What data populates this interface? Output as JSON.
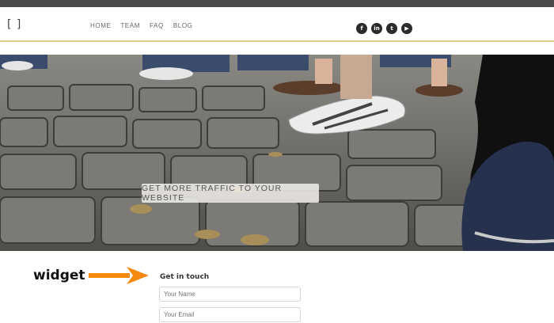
{
  "logo": "[ ]",
  "nav": {
    "items": [
      "HOME",
      "TEAM",
      "FAQ",
      "BLOG"
    ]
  },
  "social": [
    {
      "icon": "facebook-icon",
      "glyph": "f"
    },
    {
      "icon": "linkedin-icon",
      "glyph": "in"
    },
    {
      "icon": "twitter-icon",
      "glyph": "t"
    },
    {
      "icon": "youtube-icon",
      "glyph": "▶"
    }
  ],
  "hero": {
    "cta_label": "GET MORE TRAFFIC TO YOUR WEBSITE"
  },
  "annotation": {
    "label": "widget",
    "arrow_color": "#f5890f"
  },
  "form": {
    "title": "Get in touch",
    "name_placeholder": "Your Name",
    "email_placeholder": "Your Email"
  },
  "colors": {
    "accent_border": "#e8c88f",
    "topbar": "#4a4a4a"
  }
}
